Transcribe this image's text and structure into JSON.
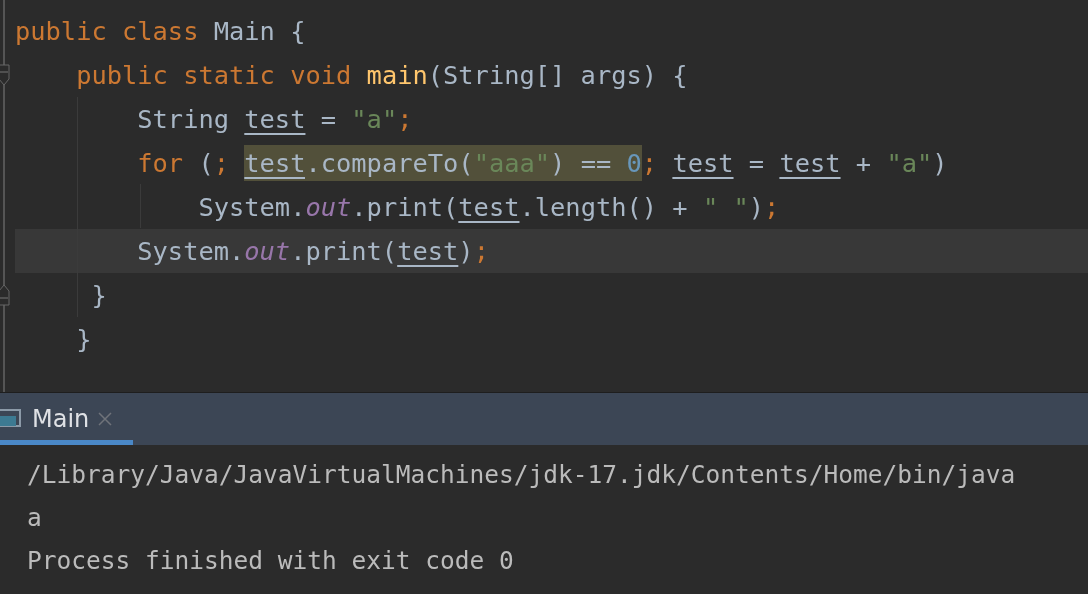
{
  "editor": {
    "lines": [
      {
        "current": false,
        "tokens": [
          {
            "kind": "keyword",
            "text": "public class "
          },
          {
            "kind": "plain",
            "text": "Main {"
          }
        ]
      },
      {
        "current": false,
        "tokens": [
          {
            "kind": "keyword",
            "text": "    public static void "
          },
          {
            "kind": "method",
            "text": "main"
          },
          {
            "kind": "plain",
            "text": "(String[] args) {"
          }
        ]
      },
      {
        "current": false,
        "tokens": [
          {
            "kind": "plain",
            "text": "        String "
          },
          {
            "kind": "var",
            "text": "test"
          },
          {
            "kind": "plain",
            "text": " = "
          },
          {
            "kind": "string",
            "text": "\"a\""
          },
          {
            "kind": "punct",
            "text": ";"
          }
        ]
      },
      {
        "current": false,
        "tokens": [
          {
            "kind": "keyword",
            "text": "        for "
          },
          {
            "kind": "plain",
            "text": "("
          },
          {
            "kind": "punct",
            "text": "; "
          },
          {
            "kind": "var",
            "text": "test",
            "highlighted": true
          },
          {
            "kind": "plain",
            "text": ".compareTo(",
            "highlighted": true
          },
          {
            "kind": "string",
            "text": "\"aaa\"",
            "highlighted": true
          },
          {
            "kind": "plain",
            "text": ") == ",
            "highlighted": true
          },
          {
            "kind": "number",
            "text": "0",
            "highlighted": true
          },
          {
            "kind": "punct",
            "text": "; "
          },
          {
            "kind": "var",
            "text": "test"
          },
          {
            "kind": "plain",
            "text": " = "
          },
          {
            "kind": "var",
            "text": "test"
          },
          {
            "kind": "plain",
            "text": " + "
          },
          {
            "kind": "string",
            "text": "\"a\""
          },
          {
            "kind": "plain",
            "text": ")"
          }
        ]
      },
      {
        "current": false,
        "tokens": [
          {
            "kind": "plain",
            "text": "            System."
          },
          {
            "kind": "field",
            "text": "out"
          },
          {
            "kind": "plain",
            "text": ".print("
          },
          {
            "kind": "var",
            "text": "test"
          },
          {
            "kind": "plain",
            "text": ".length() + "
          },
          {
            "kind": "string",
            "text": "\" \""
          },
          {
            "kind": "plain",
            "text": ")"
          },
          {
            "kind": "punct",
            "text": ";"
          }
        ]
      },
      {
        "current": true,
        "tokens": [
          {
            "kind": "plain",
            "text": "        System."
          },
          {
            "kind": "field",
            "text": "out"
          },
          {
            "kind": "plain",
            "text": ".print("
          },
          {
            "kind": "var",
            "text": "test"
          },
          {
            "kind": "plain",
            "text": ")"
          },
          {
            "kind": "punct",
            "text": ";"
          }
        ]
      },
      {
        "current": false,
        "tokens": [
          {
            "kind": "plain",
            "text": "     }"
          }
        ]
      },
      {
        "current": false,
        "tokens": [
          {
            "kind": "plain",
            "text": "    }"
          }
        ]
      }
    ]
  },
  "run_panel": {
    "tabs": [
      {
        "label": "Main",
        "selected": true
      }
    ],
    "output": [
      "/Library/Java/JavaVirtualMachines/jdk-17.jdk/Contents/Home/bin/java",
      "a",
      "Process finished with exit code 0"
    ]
  }
}
